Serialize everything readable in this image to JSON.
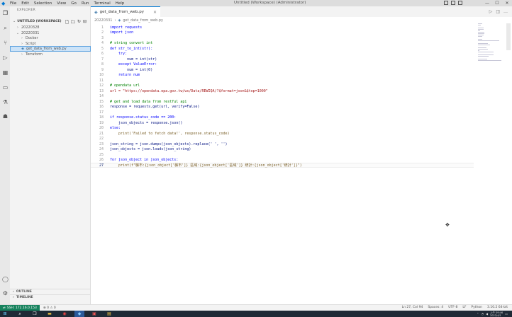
{
  "window": {
    "menu": [
      "File",
      "Edit",
      "Selection",
      "View",
      "Go",
      "Run",
      "Terminal",
      "Help"
    ],
    "title": "Untitled (Workspace) (Administrator)"
  },
  "sidebar": {
    "header": "EXPLORER",
    "workspace_label": "UNTITLED (WORKSPACE)",
    "tree": [
      {
        "label": "20220328",
        "level": 1,
        "expanded": false,
        "type": "folder"
      },
      {
        "label": "20220331",
        "level": 1,
        "expanded": true,
        "type": "folder"
      },
      {
        "label": "Docker",
        "level": 2,
        "expanded": false,
        "type": "folder"
      },
      {
        "label": "Script",
        "level": 2,
        "expanded": false,
        "type": "folder"
      },
      {
        "label": "get_data_from_web.py",
        "level": 2,
        "type": "file",
        "selected": true
      },
      {
        "label": "Terraform",
        "level": 2,
        "expanded": false,
        "type": "folder"
      }
    ],
    "outline_label": "OUTLINE",
    "timeline_label": "TIMELINE"
  },
  "editor": {
    "tab_label": "get_data_from_web.py",
    "breadcrumb": [
      "20220331",
      "get_data_from_web.py"
    ],
    "lines": [
      "import requests",
      "import json",
      "",
      "# string convert int",
      "def str_to_int(str):",
      "    try:",
      "        num = int(str)",
      "    except ValueError:",
      "        num = int(0)",
      "    return num",
      "",
      "# opendata url",
      "url = \"https://opendata.epa.gov.tw/ws/Data/REWIQA/?$format=json&$top=1000\"",
      "",
      "# get and load data from restful api",
      "response = requests.get(url, verify=False)",
      "",
      "if response.status_code == 200:",
      "    json_objects = response.json()",
      "else:",
      "    print('Failed to fetch data!', response.status_code)",
      "",
      "json_string = json.dumps(json_objects).replace(' ', '')",
      "json_objects = json.loads(json_string)",
      "",
      "for json_object in json_objects:",
      "    print(f\"縣市:{json_object['縣市']} 區域:{json_object['區域']} 統計:{json_object['統計']}\")"
    ],
    "current_line": 27
  },
  "statusbar": {
    "remote": "SSH: 172.16.0.153",
    "items": [
      "Ln 27, Col 94",
      "Spaces: 4",
      "UTF-8",
      "LF",
      "Python",
      "3.10.2 64-bit"
    ]
  },
  "taskbar": {
    "clock_time": "上午 09:46",
    "clock_date": "2022/4/1"
  },
  "colors": {
    "accent": "#0078d4",
    "remote_bg": "#16825d",
    "selection_bg": "#cce3f8"
  }
}
